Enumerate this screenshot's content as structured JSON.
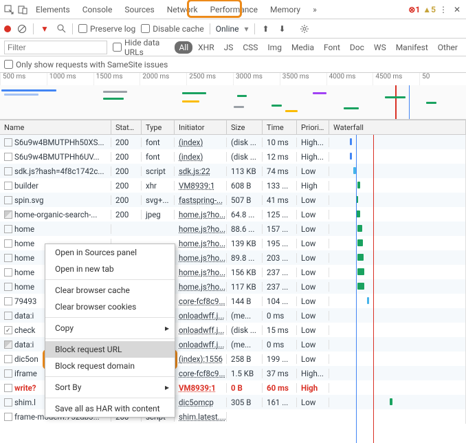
{
  "highlightColor": "#ec8a1a",
  "tabs": {
    "items": [
      "Elements",
      "Console",
      "Sources",
      "Network",
      "Performance",
      "Memory"
    ],
    "active": "Network",
    "overflow": "»"
  },
  "topbar": {
    "errors": "1",
    "warnings": "5"
  },
  "toolbar": {
    "preserve": "Preserve log",
    "disable": "Disable cache",
    "online": "Online"
  },
  "filter": {
    "placeholder": "Filter",
    "hide": "Hide data URLs",
    "types": [
      "All",
      "XHR",
      "JS",
      "CSS",
      "Img",
      "Media",
      "Font",
      "Doc",
      "WS",
      "Manifest",
      "Other"
    ],
    "active": "All"
  },
  "samesite": "Only show requests with SameSite issues",
  "timeline": {
    "ticks": [
      "500 ms",
      "1000 ms",
      "1500 ms",
      "2000 ms",
      "2500 ms",
      "3000 ms",
      "3500 ms",
      "4000 ms",
      "4500 ms",
      "50"
    ]
  },
  "columns": [
    "Name",
    "Status",
    "Type",
    "Initiator",
    "Size",
    "Time",
    "Priority",
    "Waterfall"
  ],
  "contextMenu": {
    "items": [
      {
        "label": "Open in Sources panel"
      },
      {
        "label": "Open in new tab"
      },
      {
        "sep": true
      },
      {
        "label": "Clear browser cache"
      },
      {
        "label": "Clear browser cookies"
      },
      {
        "sep": true
      },
      {
        "label": "Copy",
        "sub": true
      },
      {
        "sep": true
      },
      {
        "label": "Block request URL",
        "hl": true
      },
      {
        "label": "Block request domain"
      },
      {
        "sep": true
      },
      {
        "label": "Sort By",
        "sub": true
      },
      {
        "sep": true
      },
      {
        "label": "Save all as HAR with content"
      }
    ]
  },
  "rows": [
    {
      "name": "S6u9w4BMUTPHh50XS...",
      "status": "200",
      "type": "font",
      "init": "(index)",
      "size": "(disk ...",
      "time": "10 ms",
      "prio": "High...",
      "wf": {
        "l": 190,
        "w": 3,
        "c": "#4285f4"
      }
    },
    {
      "name": "S6u9w4BMUTPHh6UV...",
      "status": "200",
      "type": "font",
      "init": "(index)",
      "size": "(disk ...",
      "time": "12 ms",
      "prio": "High...",
      "wf": {
        "l": 190,
        "w": 3,
        "c": "#4285f4"
      }
    },
    {
      "name": "sdk.js?hash=4f8c1742c...",
      "status": "200",
      "type": "script",
      "init": "sdk.js:22",
      "size": "113 KB",
      "time": "74 ms",
      "prio": "Low",
      "wf": {
        "l": 195,
        "w": 4,
        "c": "#47b4ea"
      }
    },
    {
      "name": "builder",
      "status": "200",
      "type": "xhr",
      "init": "VM8939:1",
      "size": "608 B",
      "time": "133 ...",
      "prio": "High",
      "wf": {
        "l": 201,
        "w": 4,
        "c": "#1aa260"
      }
    },
    {
      "name": "spin.svg",
      "status": "200",
      "type": "svg+...",
      "init": "fastspring-...",
      "size": "507 B",
      "time": "41 ms",
      "prio": "Low",
      "wf": {
        "l": 199,
        "w": 3,
        "c": "#1aa260"
      }
    },
    {
      "name": "home-organic-search-...",
      "status": "200",
      "type": "jpeg",
      "init": "home.js?ho...",
      "size": "64.8 ...",
      "time": "125 ...",
      "prio": "Low",
      "icon": "img",
      "wf": {
        "l": 199,
        "w": 6,
        "c": "#1aa260"
      }
    },
    {
      "name": "home",
      "init": "home.js?ho...",
      "size": "88.6 ...",
      "time": "157 ...",
      "prio": "Low",
      "wf": {
        "l": 201,
        "w": 7,
        "c": "#1aa260"
      }
    },
    {
      "name": "home",
      "init": "home.js?ho...",
      "size": "139 KB",
      "time": "195 ...",
      "prio": "Low",
      "wf": {
        "l": 201,
        "w": 8,
        "c": "#1aa260"
      }
    },
    {
      "name": "home",
      "init": "home.js?ho...",
      "size": "89.8 ...",
      "time": "203 ...",
      "prio": "Low",
      "wf": {
        "l": 201,
        "w": 9,
        "c": "#1aa260"
      }
    },
    {
      "name": "home",
      "init": "home.js?ho...",
      "size": "156 KB",
      "time": "237 ...",
      "prio": "Low",
      "wf": {
        "l": 201,
        "w": 10,
        "c": "#1aa260"
      }
    },
    {
      "name": "home",
      "init": "home.js?ho...",
      "size": "117 KB",
      "time": "237 ...",
      "prio": "Low",
      "wf": {
        "l": 201,
        "w": 10,
        "c": "#1aa260"
      }
    },
    {
      "name": "79493",
      "init": "core-fcf8c9...",
      "size": "144 B",
      "time": "104 ...",
      "prio": "Low",
      "wf": {
        "l": 215,
        "w": 3,
        "c": "#47b4ea"
      }
    },
    {
      "name": "data:i",
      "init": "onloadwff.j...",
      "size": "(me...",
      "time": "0 ms",
      "prio": "Low"
    },
    {
      "name": "check",
      "status": "",
      "type": "",
      "init": "onloadwff.j...",
      "size": "(disk ...",
      "time": "15 ms",
      "prio": "Low",
      "icon": "check"
    },
    {
      "name": "data:i",
      "init": "onloadwff.j...",
      "size": "(me...",
      "time": "0 ms",
      "prio": "Low",
      "icon": "img"
    },
    {
      "name": "dic5on",
      "init": "(index):1556",
      "size": "258 B",
      "time": "199 ...",
      "prio": "Low"
    },
    {
      "name": "iframe",
      "init": "core-fcf8c9...",
      "size": "1.5 KB",
      "time": "37 ms",
      "prio": "High..."
    },
    {
      "name": "write?",
      "init": "VM8939:1",
      "size": "0 B",
      "time": "60 ms",
      "prio": "High",
      "err": true
    },
    {
      "name": "shim.l",
      "init": "dic5omcp",
      "size": "305 B",
      "time": "161 ...",
      "prio": "Low",
      "wf": {
        "l": 248,
        "w": 4,
        "c": "#1aa260"
      }
    },
    {
      "name": "frame-modern.752db3...",
      "status": "200",
      "type": "script",
      "init": "shim.latest....",
      "size": "",
      "time": "",
      "prio": ""
    }
  ]
}
